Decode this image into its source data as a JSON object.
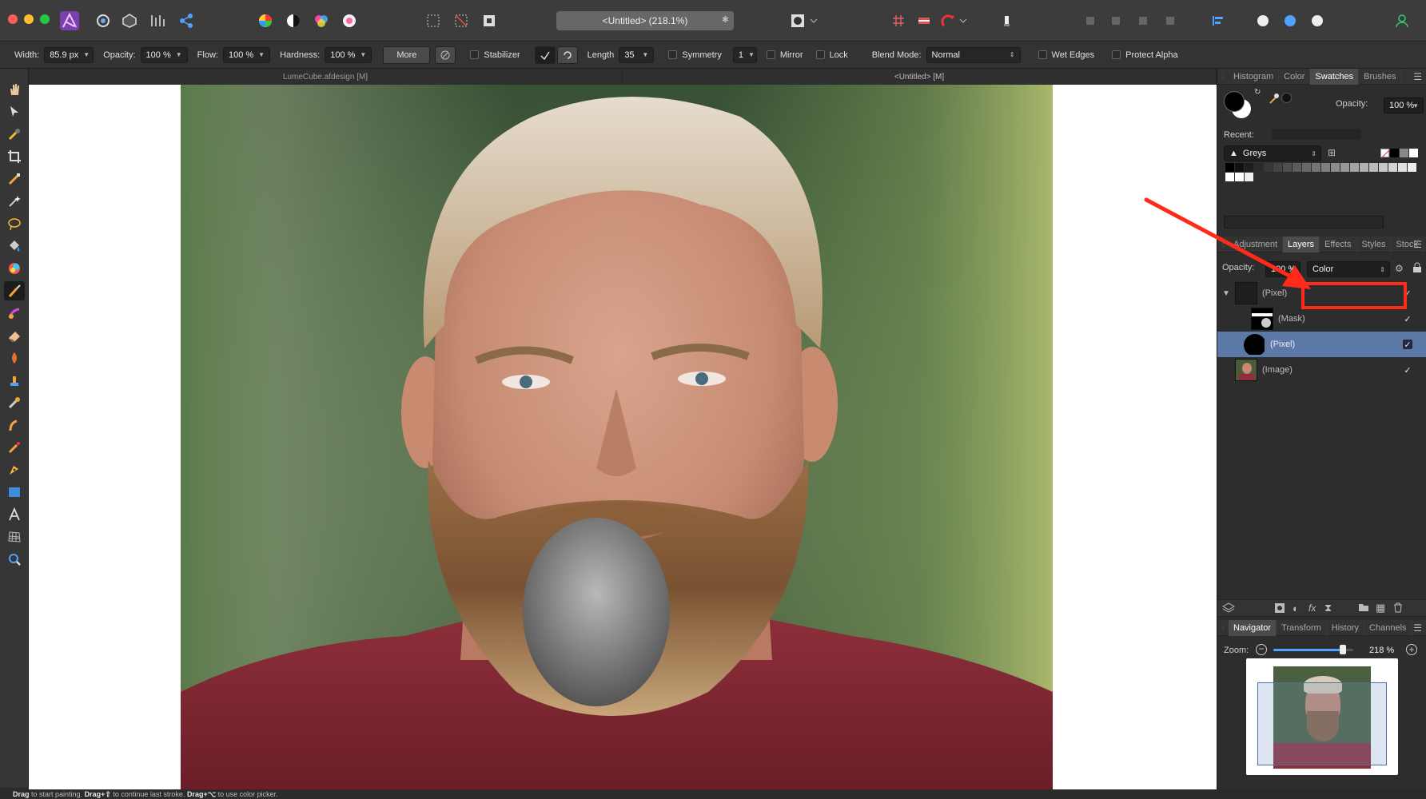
{
  "window": {
    "title": "<Untitled> (218.1%)",
    "modified_marker": "✱"
  },
  "colors": {
    "accent_blue": "#5b78a6",
    "annotation_red": "#ff2a1a",
    "app_icon_purple": "#7b3fb0"
  },
  "toolbar_icons": [
    "affinity-photo-app-icon",
    "liquify-persona-icon",
    "develop-persona-icon",
    "tone-mapping-persona-icon",
    "export-persona-icon",
    "color-wheel-icon",
    "contrast-icon",
    "hsl-icon",
    "white-balance-icon",
    "marquee-selection-icon",
    "deselect-icon",
    "invert-selection-icon",
    "quick-mask-icon",
    "grid-icon",
    "snapping-icon",
    "magnet-icon",
    "paint-bucket-icon",
    "arrange-icons",
    "align-icon",
    "studio-link-icons",
    "user-icon"
  ],
  "context_toolbar": {
    "width_label": "Width:",
    "width_value": "85.9 px",
    "opacity_label": "Opacity:",
    "opacity_value": "100 %",
    "flow_label": "Flow:",
    "flow_value": "100 %",
    "hardness_label": "Hardness:",
    "hardness_value": "100 %",
    "more_label": "More",
    "stabilizer_label": "Stabilizer",
    "length_label": "Length",
    "length_value": "35",
    "symmetry_label": "Symmetry",
    "symmetry_value": "1",
    "mirror_label": "Mirror",
    "lock_label": "Lock",
    "blend_mode_label": "Blend Mode:",
    "blend_mode_value": "Normal",
    "wet_edges_label": "Wet Edges",
    "protect_alpha_label": "Protect Alpha"
  },
  "document_tabs": [
    {
      "label": "LumeCube.afdesign [M]",
      "active": false
    },
    {
      "label": "<Untitled> [M]",
      "active": true
    }
  ],
  "tools": [
    "view-tool-hand-icon",
    "move-tool-icon",
    "color-picker-tool-icon",
    "crop-tool-icon",
    "selection-brush-tool-icon",
    "flood-select-tool-icon",
    "freehand-selection-tool-icon",
    "flood-fill-tool-icon",
    "gradient-tool-icon",
    "paint-brush-tool-icon",
    "paint-mixer-brush-tool-icon",
    "erase-brush-tool-icon",
    "dodge-brush-tool-icon",
    "clone-brush-tool-icon",
    "blemish-removal-tool-icon",
    "smudge-brush-tool-icon",
    "red-eye-tool-icon",
    "pen-tool-icon",
    "rectangle-tool-icon",
    "artistic-text-tool-icon",
    "mesh-warp-tool-icon",
    "zoom-tool-icon"
  ],
  "status_bar": {
    "k1": "Drag",
    "t1": " to start painting. ",
    "k2": "Drag+⇧",
    "t2": " to continue last stroke. ",
    "k3": "Drag+⌥",
    "t3": " to use color picker."
  },
  "swatches_panel": {
    "tabs": [
      {
        "label": "Histogram",
        "active": false
      },
      {
        "label": "Color",
        "active": false
      },
      {
        "label": "Swatches",
        "active": true
      },
      {
        "label": "Brushes",
        "active": false
      }
    ],
    "opacity_label": "Opacity:",
    "opacity_value": "100 %",
    "recent_label": "Recent:",
    "palette_name": "Greys"
  },
  "layers_panel": {
    "tabs": [
      {
        "label": "Adjustment",
        "active": false
      },
      {
        "label": "Layers",
        "active": true
      },
      {
        "label": "Effects",
        "active": false
      },
      {
        "label": "Styles",
        "active": false
      },
      {
        "label": "Stock",
        "active": false
      }
    ],
    "opacity_label": "Opacity:",
    "opacity_value": "100 %",
    "blend_mode_value": "Color",
    "layers": [
      {
        "name": "(Pixel)",
        "kind": "group-pixel",
        "visible": true,
        "selected": false
      },
      {
        "name": "(Mask)",
        "kind": "mask",
        "visible": true,
        "selected": false
      },
      {
        "name": "(Pixel)",
        "kind": "pixel",
        "visible": true,
        "selected": true
      },
      {
        "name": "(Image)",
        "kind": "image",
        "visible": true,
        "selected": false
      }
    ],
    "footer_icons": [
      "layers-stack-icon",
      "mask-icon",
      "adjustment-icon",
      "fx-icon",
      "live-filter-icon",
      "folder-icon",
      "pixel-layer-icon",
      "trash-icon"
    ]
  },
  "navigator_panel": {
    "tabs": [
      {
        "label": "Navigator",
        "active": true
      },
      {
        "label": "Transform",
        "active": false
      },
      {
        "label": "History",
        "active": false
      },
      {
        "label": "Channels",
        "active": false
      }
    ],
    "zoom_label": "Zoom:",
    "zoom_value": "218 %",
    "zoom_fraction": 0.87
  },
  "annotation": {
    "arrow_color": "#ff2a1a",
    "highlight_target": "layers-blend-mode-select"
  }
}
